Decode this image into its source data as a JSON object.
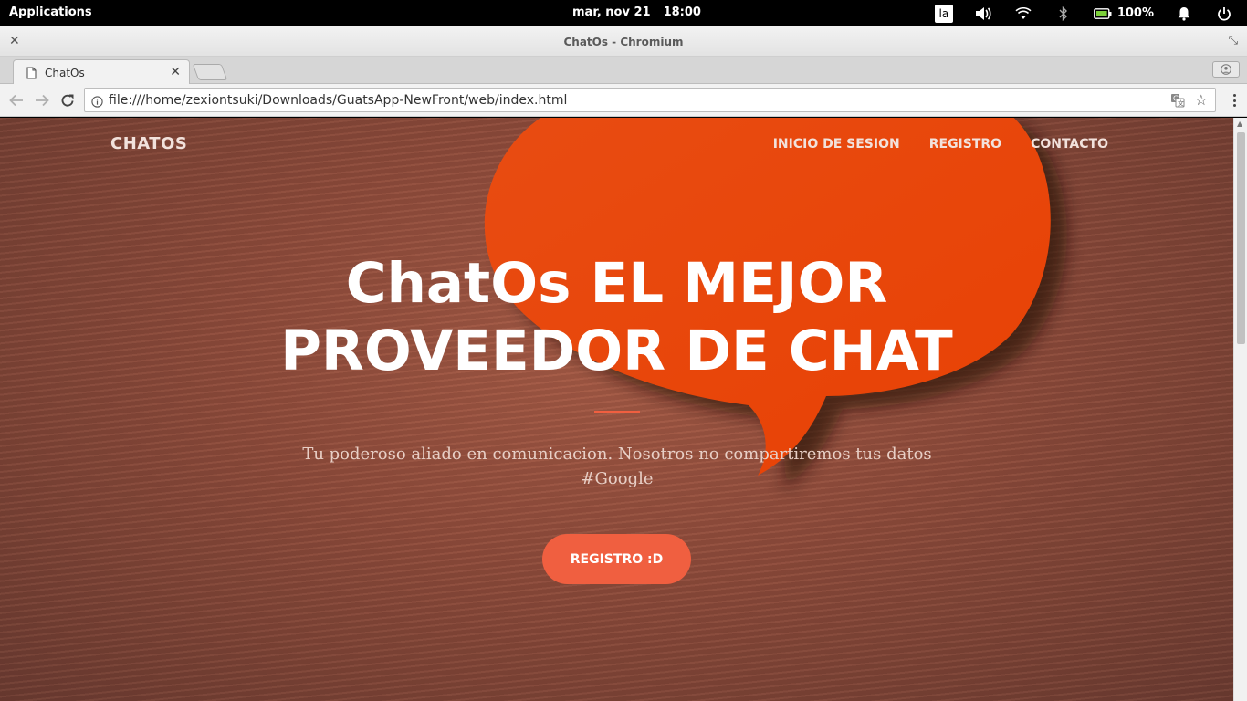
{
  "system_panel": {
    "applications": "Applications",
    "date": "mar, nov 21",
    "time": "18:00",
    "keyboard_layout": "la",
    "battery_percent": "100%",
    "icons": [
      "volume-icon",
      "wifi-icon",
      "bluetooth-icon",
      "battery-icon",
      "notification-bell-icon",
      "power-icon"
    ]
  },
  "window": {
    "title": "ChatOs - Chromium"
  },
  "browser": {
    "tab_title": "ChatOs",
    "url": "file:///home/zexiontsuki/Downloads/GuatsApp-NewFront/web/index.html"
  },
  "site": {
    "brand": "CHATOS",
    "nav": [
      "INICIO DE SESION",
      "REGISTRO",
      "CONTACTO"
    ],
    "hero_title_line1": "ChatOs EL MEJOR",
    "hero_title_line2": "PROVEEDOR DE CHAT",
    "subtitle_line1": "Tu poderoso aliado en comunicacion. Nosotros no compartiremos tus datos",
    "subtitle_line2": "#Google",
    "cta_label": "REGISTRO :D",
    "colors": {
      "accent": "#f05f40",
      "bubble": "#ea4a0a"
    }
  }
}
